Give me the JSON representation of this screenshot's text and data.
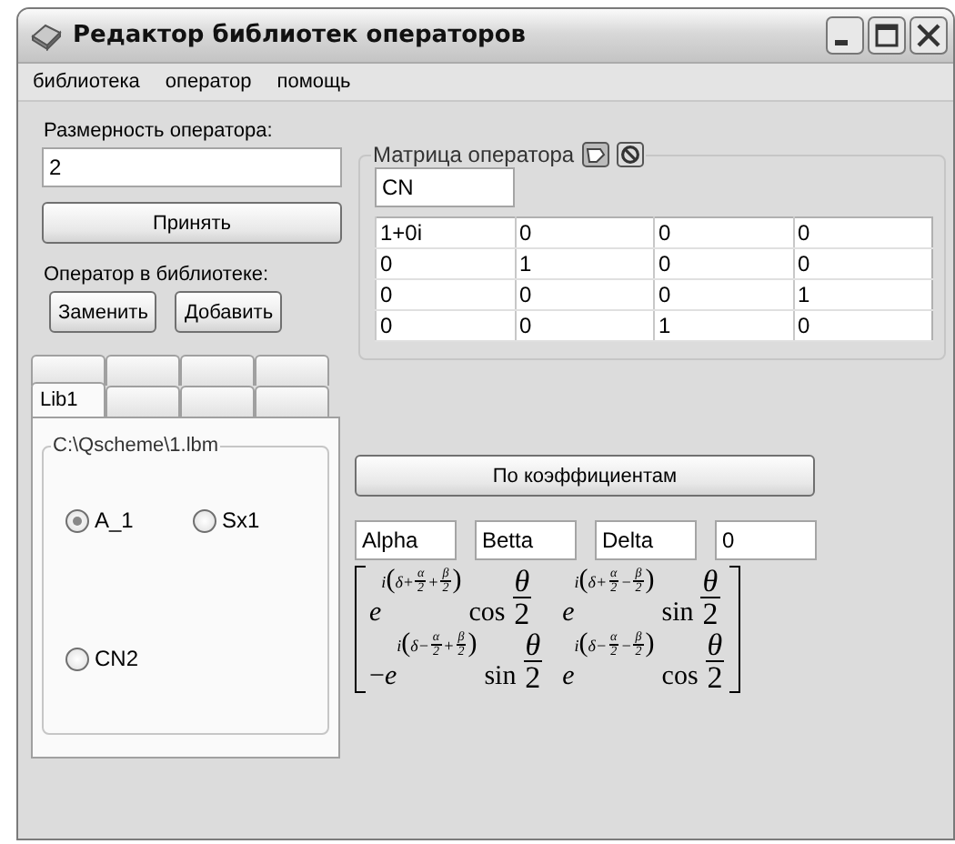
{
  "window": {
    "title": "Редактор библиотек операторов"
  },
  "menu": [
    "библиотека",
    "оператор",
    "помощь"
  ],
  "dimension": {
    "label": "Размерность оператора:",
    "value": "2",
    "button": "Принять"
  },
  "library": {
    "label": "Оператор в библиотеке:",
    "buttons": [
      "Заменить",
      "Добавить"
    ]
  },
  "matrix_group": {
    "title": "Матрица оператора",
    "name": "CN",
    "rows": [
      [
        "1+0i",
        "0",
        "0",
        "0"
      ],
      [
        "0",
        "1",
        "0",
        "0"
      ],
      [
        "0",
        "0",
        "0",
        "1"
      ],
      [
        "0",
        "0",
        "1",
        "0"
      ]
    ]
  },
  "tabs": [
    [
      {
        "selected": false
      },
      {
        "selected": false
      },
      {
        "selected": false
      },
      {
        "selected": false
      }
    ],
    [
      {
        "label": "Lib1",
        "selected": true
      },
      {
        "selected": false
      },
      {
        "selected": false
      },
      {
        "selected": false
      }
    ]
  ],
  "library_file": {
    "path": "C:\\Qscheme\\1.lbm",
    "operators": [
      {
        "label": "A_1",
        "selected": true
      },
      {
        "label": "Sx1",
        "selected": false
      },
      {
        "label": "CN2",
        "selected": false
      }
    ]
  },
  "coefficients_button": "По коэффициентам",
  "parameters": [
    "Alpha",
    "Betta",
    "Delta",
    "0"
  ],
  "formula": {
    "cells": [
      {
        "base": "e",
        "exponent": [
          {
            "text": "i(δ+"
          },
          {
            "num": "α",
            "den": "2"
          },
          {
            "text": "+"
          },
          {
            "num": "β",
            "den": "2"
          },
          {
            "text": ")"
          }
        ],
        "function": "cos",
        "argument": {
          "num": "θ",
          "den": "2"
        }
      },
      {
        "base": "e",
        "exponent": [
          {
            "text": "i(δ+"
          },
          {
            "num": "α",
            "den": "2"
          },
          {
            "text": "−"
          },
          {
            "num": "β",
            "den": "2"
          },
          {
            "text": ")"
          }
        ],
        "function": "sin",
        "argument": {
          "num": "θ",
          "den": "2"
        }
      },
      {
        "sign": "−",
        "base": "e",
        "exponent": [
          {
            "text": "i(δ−"
          },
          {
            "num": "α",
            "den": "2"
          },
          {
            "text": "+"
          },
          {
            "num": "β",
            "den": "2"
          },
          {
            "text": ")"
          }
        ],
        "function": "sin",
        "argument": {
          "num": "θ",
          "den": "2"
        }
      },
      {
        "base": "e",
        "exponent": [
          {
            "text": "i(δ−"
          },
          {
            "num": "α",
            "den": "2"
          },
          {
            "text": "−"
          },
          {
            "num": "β",
            "den": "2"
          },
          {
            "text": ")"
          }
        ],
        "function": "cos",
        "argument": {
          "num": "θ",
          "den": "2"
        }
      }
    ]
  }
}
